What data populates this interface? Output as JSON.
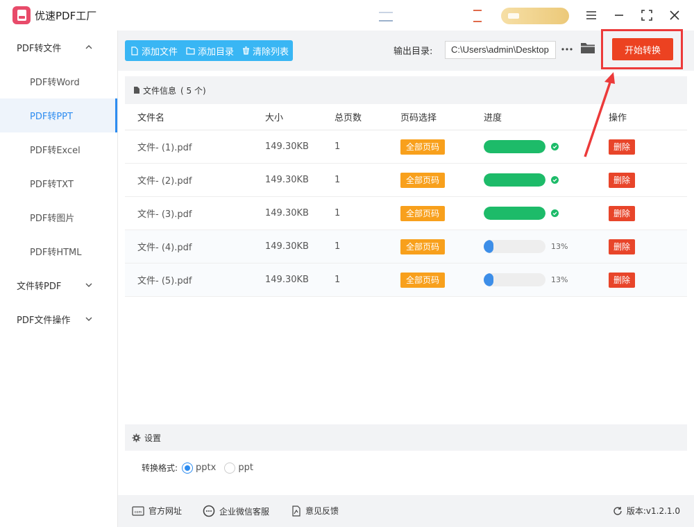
{
  "app": {
    "title": "优速PDF工厂"
  },
  "sidebar": {
    "groups": [
      {
        "label": "PDF转文件",
        "expanded": true
      },
      {
        "label": "文件转PDF",
        "expanded": false
      },
      {
        "label": "PDF文件操作",
        "expanded": false
      }
    ],
    "items": [
      {
        "label": "PDF转Word"
      },
      {
        "label": "PDF转PPT",
        "active": true
      },
      {
        "label": "PDF转Excel"
      },
      {
        "label": "PDF转TXT"
      },
      {
        "label": "PDF转图片"
      },
      {
        "label": "PDF转HTML"
      }
    ]
  },
  "toolbar": {
    "add_file": "添加文件",
    "add_dir": "添加目录",
    "clear_list": "清除列表",
    "output_label": "输出目录:",
    "output_path": "C:\\Users\\admin\\Desktop",
    "start": "开始转换"
  },
  "files": {
    "header_label": "文件信息",
    "count_text": "( 5 个)",
    "columns": [
      "文件名",
      "大小",
      "总页数",
      "页码选择",
      "进度",
      "操作"
    ],
    "page_select_label": "全部页码",
    "delete_label": "删除",
    "rows": [
      {
        "name": "文件- (1).pdf",
        "size": "149.30KB",
        "pages": "1",
        "progress": 1.0,
        "pct": "",
        "done": true
      },
      {
        "name": "文件- (2).pdf",
        "size": "149.30KB",
        "pages": "1",
        "progress": 1.0,
        "pct": "",
        "done": true
      },
      {
        "name": "文件- (3).pdf",
        "size": "149.30KB",
        "pages": "1",
        "progress": 1.0,
        "pct": "",
        "done": true
      },
      {
        "name": "文件- (4).pdf",
        "size": "149.30KB",
        "pages": "1",
        "progress": 0.13,
        "pct": "13%",
        "done": false
      },
      {
        "name": "文件- (5).pdf",
        "size": "149.30KB",
        "pages": "1",
        "progress": 0.13,
        "pct": "13%",
        "done": false
      }
    ]
  },
  "settings": {
    "title": "设置",
    "format_label": "转换格式:",
    "options": [
      {
        "label": "pptx",
        "selected": true
      },
      {
        "label": "ppt",
        "selected": false
      }
    ]
  },
  "footer": {
    "website": "官方网址",
    "wechat": "企业微信客服",
    "feedback": "意见反馈",
    "version": "版本:v1.2.1.0"
  },
  "colors": {
    "accent": "#2d8cf0",
    "toolbar_btn": "#39b6f4",
    "start": "#ec4221",
    "progress_done": "#1dbb69",
    "progress_active": "#3d8ee8",
    "page_select": "#f8a01c",
    "delete": "#e8452a",
    "annotation": "#ec3a3a"
  }
}
